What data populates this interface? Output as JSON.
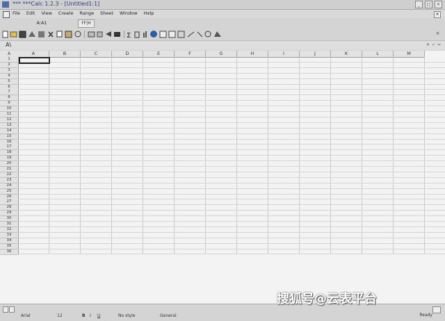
{
  "window": {
    "title": "*** ***Calc 1.2.3 - [Untitled1:1]"
  },
  "menu": [
    "File",
    "Edit",
    "View",
    "Create",
    "Range",
    "Sheet",
    "Window",
    "Help"
  ],
  "toolbar": {
    "cell_ref": "A:A1",
    "fx_label": "FF|H"
  },
  "formula": {
    "cell_content": "A\\"
  },
  "grid": {
    "corner": "A",
    "columns": [
      "A",
      "B",
      "C",
      "D",
      "E",
      "F",
      "G",
      "H",
      "I",
      "J",
      "K",
      "L",
      "M"
    ],
    "rows": [
      "1",
      "2",
      "3",
      "4",
      "5",
      "6",
      "7",
      "8",
      "9",
      "10",
      "11",
      "12",
      "13",
      "14",
      "15",
      "16",
      "17",
      "18",
      "19",
      "20",
      "21",
      "22",
      "23",
      "24",
      "25",
      "26",
      "27",
      "28",
      "29",
      "30",
      "31",
      "32",
      "33",
      "34",
      "35",
      "36"
    ]
  },
  "status": {
    "font": "Arial",
    "size": "12",
    "style_flags": [
      "B",
      "I",
      "U"
    ],
    "style": "No style",
    "format": "General",
    "ready": "Ready"
  },
  "watermark": "搜狐号@云表平台",
  "colors": {
    "title_text": "#2a3f7f",
    "chrome": "#d4d4d4",
    "grid_bg": "#f3f3f3"
  }
}
